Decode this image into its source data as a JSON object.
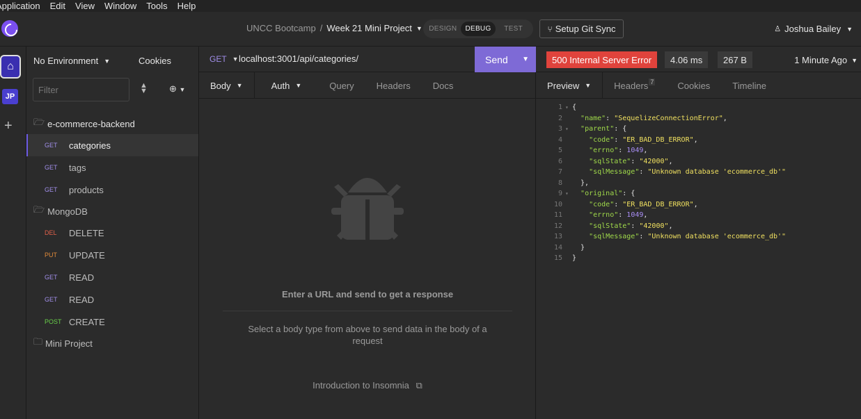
{
  "menu": [
    "Application",
    "Edit",
    "View",
    "Window",
    "Tools",
    "Help"
  ],
  "header": {
    "org": "UNCC Bootcamp",
    "separator": "/",
    "project": "Week 21 Mini Project",
    "modes": [
      "DESIGN",
      "DEBUG",
      "TEST"
    ],
    "active_mode": "DEBUG",
    "git_sync": "Setup Git Sync",
    "user": "Joshua Bailey"
  },
  "rail": {
    "workspace_initials": "JP"
  },
  "sidebar": {
    "environment": "No Environment",
    "cookies": "Cookies",
    "filter_placeholder": "Filter",
    "folders": [
      {
        "name": "e-commerce-backend",
        "open": true
      },
      {
        "name": "MongoDB",
        "open": true
      },
      {
        "name": "Mini Project",
        "open": false
      }
    ],
    "requests_ecommerce": [
      {
        "method": "GET",
        "name": "categories",
        "selected": true
      },
      {
        "method": "GET",
        "name": "tags"
      },
      {
        "method": "GET",
        "name": "products"
      }
    ],
    "requests_mongodb": [
      {
        "method": "DEL",
        "name": "DELETE"
      },
      {
        "method": "PUT",
        "name": "UPDATE"
      },
      {
        "method": "GET",
        "name": "READ"
      },
      {
        "method": "GET",
        "name": "READ"
      },
      {
        "method": "POST",
        "name": "CREATE"
      }
    ]
  },
  "request": {
    "method": "GET",
    "url": "localhost:3001/api/categories/",
    "send_label": "Send",
    "tabs": [
      "Body",
      "Auth",
      "Query",
      "Headers",
      "Docs"
    ],
    "empty_title": "Enter a URL and send to get a response",
    "empty_subtitle": "Select a body type from above to send data in the body of a request",
    "intro_link": "Introduction to Insomnia"
  },
  "response": {
    "status": "500 Internal Server Error",
    "time": "4.06 ms",
    "size": "267 B",
    "ago": "1 Minute Ago",
    "tabs": [
      "Preview",
      "Headers",
      "Cookies",
      "Timeline"
    ],
    "headers_count": "7",
    "colors": {
      "status": "#e0433c",
      "key": "#9fd84a",
      "string": "#f0e060",
      "number": "#a98ef5"
    },
    "body_lines": [
      "{",
      "  \"name\": \"SequelizeConnectionError\",",
      "  \"parent\": {",
      "    \"code\": \"ER_BAD_DB_ERROR\",",
      "    \"errno\": 1049,",
      "    \"sqlState\": \"42000\",",
      "    \"sqlMessage\": \"Unknown database 'ecommerce_db'\"",
      "  },",
      "  \"original\": {",
      "    \"code\": \"ER_BAD_DB_ERROR\",",
      "    \"errno\": 1049,",
      "    \"sqlState\": \"42000\",",
      "    \"sqlMessage\": \"Unknown database 'ecommerce_db'\"",
      "  }",
      "}"
    ]
  }
}
